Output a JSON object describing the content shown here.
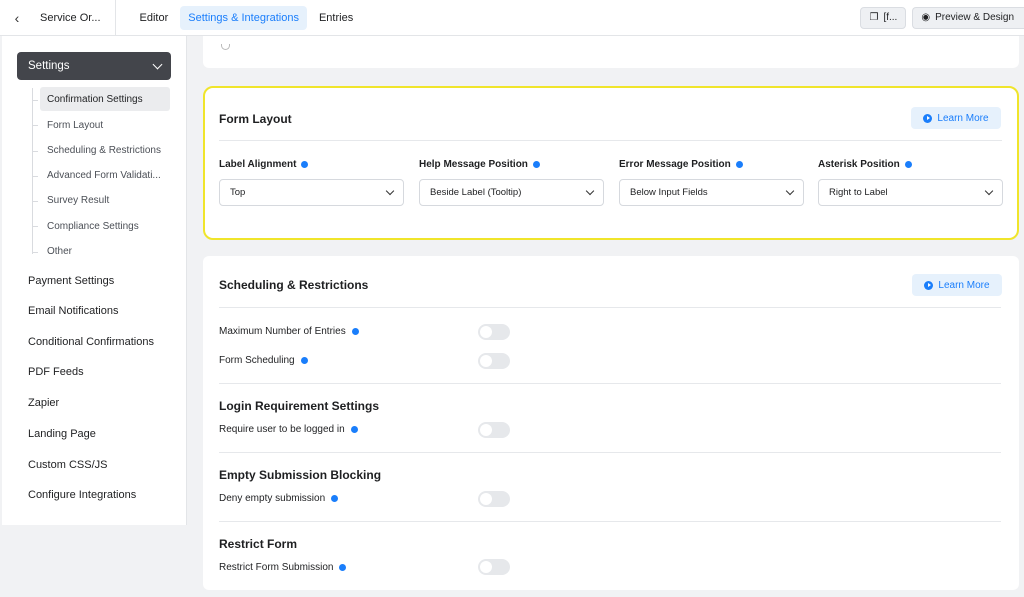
{
  "topbar": {
    "back_icon": "chevron-left-icon",
    "form_name": "Service Or...",
    "tabs": [
      {
        "label": "Editor",
        "active": false
      },
      {
        "label": "Settings & Integrations",
        "active": true
      },
      {
        "label": "Entries",
        "active": false
      }
    ],
    "shortcode_label": "[f...",
    "preview_label": "Preview & Design"
  },
  "sidebar": {
    "settings_label": "Settings",
    "sub_items": [
      {
        "label": "Confirmation Settings",
        "active": true
      },
      {
        "label": "Form Layout",
        "active": false
      },
      {
        "label": "Scheduling & Restrictions",
        "active": false
      },
      {
        "label": "Advanced Form Validati...",
        "active": false
      },
      {
        "label": "Survey Result",
        "active": false
      },
      {
        "label": "Compliance Settings",
        "active": false
      },
      {
        "label": "Other",
        "active": false
      }
    ],
    "main_items": [
      "Payment Settings",
      "Email Notifications",
      "Conditional Confirmations",
      "PDF Feeds",
      "Zapier",
      "Landing Page",
      "Custom CSS/JS",
      "Configure Integrations"
    ]
  },
  "form_layout": {
    "title": "Form Layout",
    "learn_more": "Learn More",
    "fields": [
      {
        "label": "Label Alignment",
        "value": "Top"
      },
      {
        "label": "Help Message Position",
        "value": "Beside Label (Tooltip)"
      },
      {
        "label": "Error Message Position",
        "value": "Below Input Fields"
      },
      {
        "label": "Asterisk Position",
        "value": "Right to Label"
      }
    ]
  },
  "scheduling": {
    "title": "Scheduling & Restrictions",
    "learn_more": "Learn More",
    "max_entries_label": "Maximum Number of Entries",
    "form_scheduling_label": "Form Scheduling",
    "login_title": "Login Requirement Settings",
    "login_label": "Require user to be logged in",
    "empty_title": "Empty Submission Blocking",
    "empty_label": "Deny empty submission",
    "restrict_title": "Restrict Form",
    "restrict_label": "Restrict Form Submission"
  },
  "colors": {
    "accent": "#1a7efb",
    "highlight_border": "#f0e52b",
    "settings_bg": "#43454b"
  }
}
